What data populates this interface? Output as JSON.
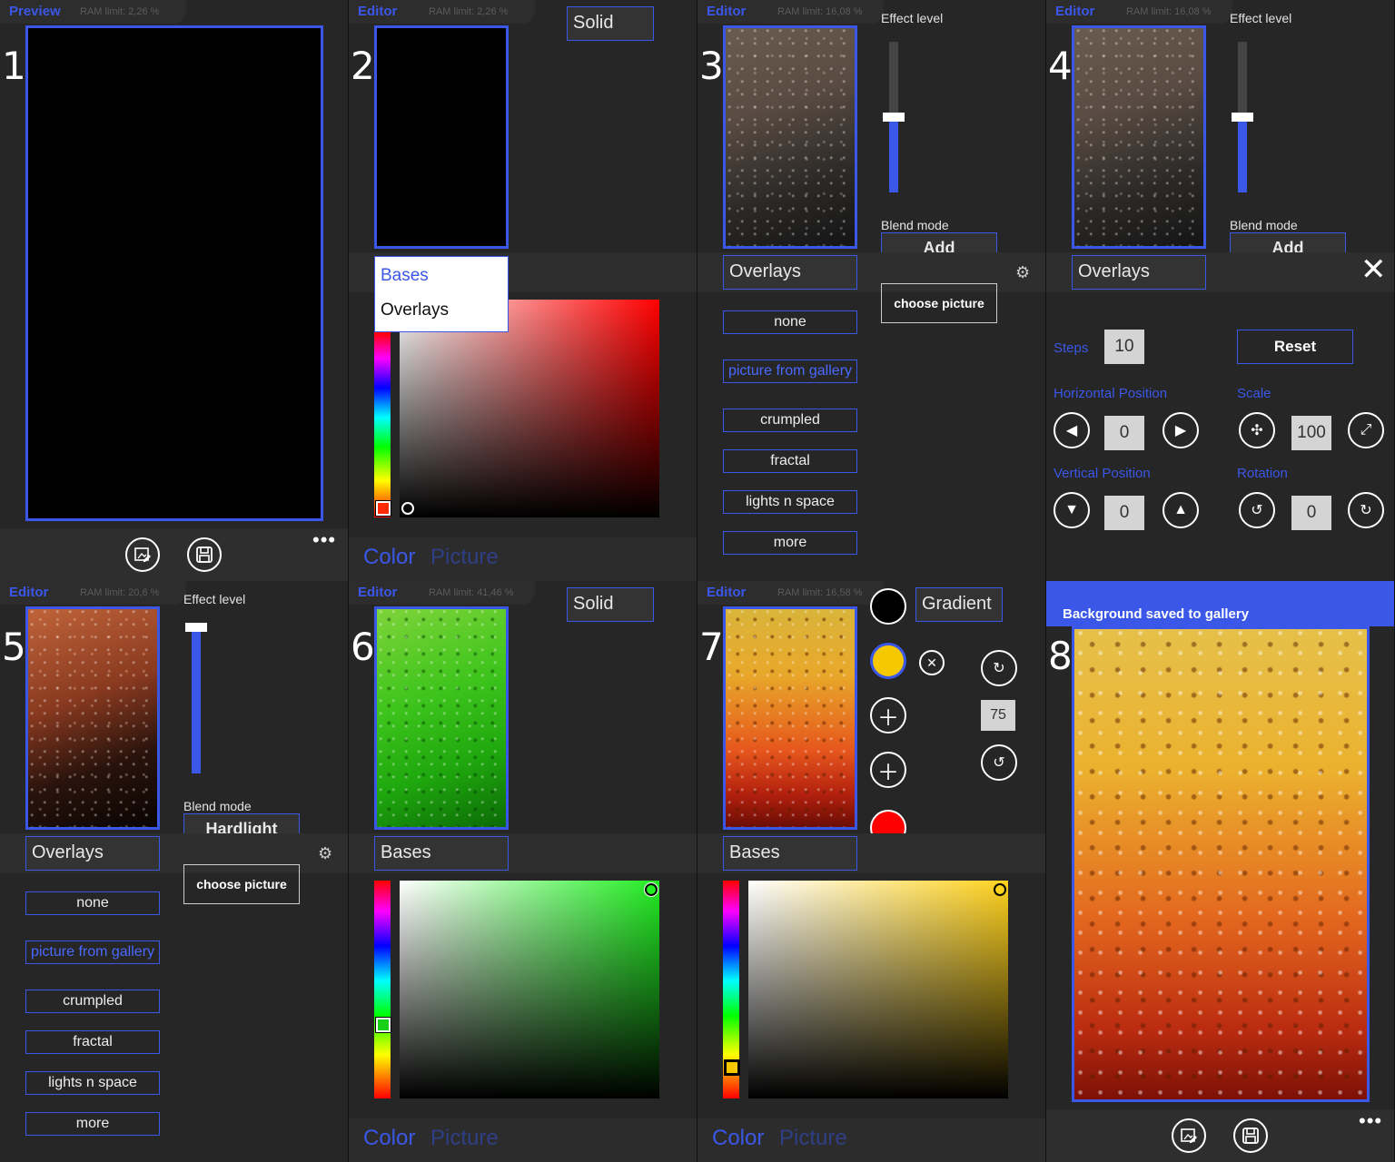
{
  "panels": {
    "p1": {
      "title": "Preview",
      "ram": "RAM limit: 2,26 %",
      "num": "1",
      "dots": "•••"
    },
    "p2": {
      "title": "Editor",
      "ram": "RAM limit: 2,26 %",
      "num": "2",
      "mode": "Solid",
      "popup": [
        "Bases",
        "Overlays"
      ],
      "tab_color": "Color",
      "tab_picture": "Picture"
    },
    "p3": {
      "title": "Editor",
      "ram": "RAM limit: 16,08 %",
      "num": "3",
      "effect": "Effect level",
      "blend_label": "Blend mode",
      "blend": "Add",
      "dropdown": "Overlays",
      "choose": "choose picture",
      "list": [
        "none",
        "picture from gallery",
        "crumpled",
        "fractal",
        "lights n space",
        "more"
      ]
    },
    "p4": {
      "title": "Editor",
      "ram": "RAM limit: 16,08 %",
      "num": "4",
      "effect": "Effect level",
      "blend_label": "Blend mode",
      "blend": "Add",
      "dropdown": "Overlays",
      "steps_label": "Steps",
      "steps": "10",
      "reset": "Reset",
      "hpos": "Horizontal Position",
      "hval": "0",
      "scale": "Scale",
      "sval": "100",
      "vpos": "Vertical Position",
      "vval": "0",
      "rotation": "Rotation",
      "rval": "0"
    },
    "p5": {
      "title": "Editor",
      "ram": "RAM limit: 20,6 %",
      "num": "5",
      "effect": "Effect level",
      "blend_label": "Blend mode",
      "blend": "Hardlight",
      "dropdown": "Overlays",
      "choose": "choose picture",
      "list": [
        "none",
        "picture from gallery",
        "crumpled",
        "fractal",
        "lights n space",
        "more"
      ]
    },
    "p6": {
      "title": "Editor",
      "ram": "RAM limit: 41,46 %",
      "num": "6",
      "mode": "Solid",
      "dropdown": "Bases",
      "tab_color": "Color",
      "tab_picture": "Picture"
    },
    "p7": {
      "title": "Editor",
      "ram": "RAM limit: 16,58 %",
      "num": "7",
      "mode": "Gradient",
      "angle": "75",
      "dropdown": "Bases",
      "tab_color": "Color",
      "tab_picture": "Picture"
    },
    "p8": {
      "toast": "Background saved to gallery",
      "num": "8",
      "dots": "•••"
    }
  },
  "colors": {
    "accent": "#3b57e8",
    "panel": "#262626",
    "band": "#2e2e2e"
  },
  "icons": {
    "edit": "edit-image-icon",
    "save": "save-icon",
    "gear": "gear-icon",
    "close": "close-icon"
  }
}
